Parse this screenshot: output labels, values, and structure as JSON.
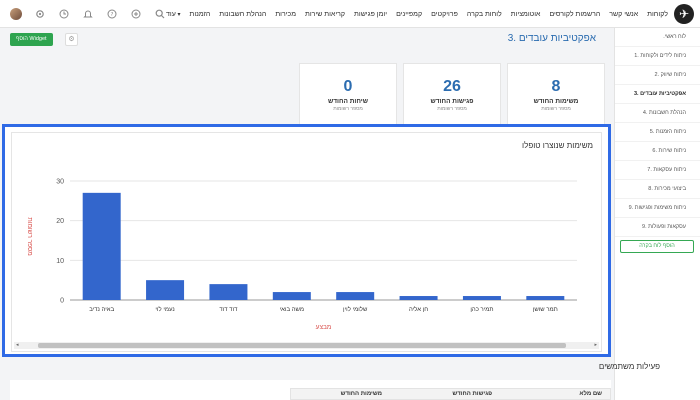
{
  "nav": {
    "items": [
      "לקוחות",
      "אנשי קשר",
      "הרשמות לקורסים",
      "אוטומציות",
      "לוחות בקרה",
      "פרויקטים",
      "קמפיינים",
      "יומן פגישות",
      "קריאות שירות",
      "מכירות",
      "הנהלת חשבונות",
      "הזמנות",
      "עוד"
    ]
  },
  "sidebar": {
    "items": [
      ".לוח ראשי",
      "1. ניתוח לידים ולקוחות",
      "2. ניתוח שיווק",
      "3. אפקטיביות עובדים",
      "4. הנהלת חשבונות",
      "5. ניתוח הזמנות",
      "6. ניתוח שירות",
      "7. ניתוח עסקאות",
      "8. ביצועי מכירות",
      "9. ניתוח משימות ופגישות",
      "9. עסקאות ופעולות"
    ],
    "add_label": "הוסף לוח בקרה"
  },
  "header": {
    "title": "3. אפקטיביות עובדים",
    "add_widget_label": "הוסף Widget"
  },
  "kpis": [
    {
      "value": "8",
      "label": "משימות החודש",
      "sub": "מספר רשומות"
    },
    {
      "value": "26",
      "label": "פגישות החודש",
      "sub": "מספר רשומות"
    },
    {
      "value": "0",
      "label": "שיחות החודש",
      "sub": "מספר רשומות"
    }
  ],
  "chart_data": {
    "type": "bar",
    "title": "משימות שנוצרו טופלו",
    "xlabel": "מבצע",
    "ylabel": "מספר רשומות",
    "categories": [
      "באיה נדיב",
      "נעמי לוי",
      "דוד דוד",
      "משה בואי",
      "שלומי לוין",
      "חן אליה",
      "תמיר כהן",
      "תמר שושן"
    ],
    "values": [
      27,
      5,
      4,
      2,
      2,
      1,
      1,
      1
    ],
    "ylim": [
      0,
      32
    ],
    "yticks": [
      "0",
      "10",
      "20",
      "30"
    ],
    "grid": true,
    "color": "#3366cc"
  },
  "activity": {
    "title": "פעילות משתמשים",
    "columns": [
      "שם מלא",
      "פגישות החודש",
      "משימות החודש"
    ]
  }
}
